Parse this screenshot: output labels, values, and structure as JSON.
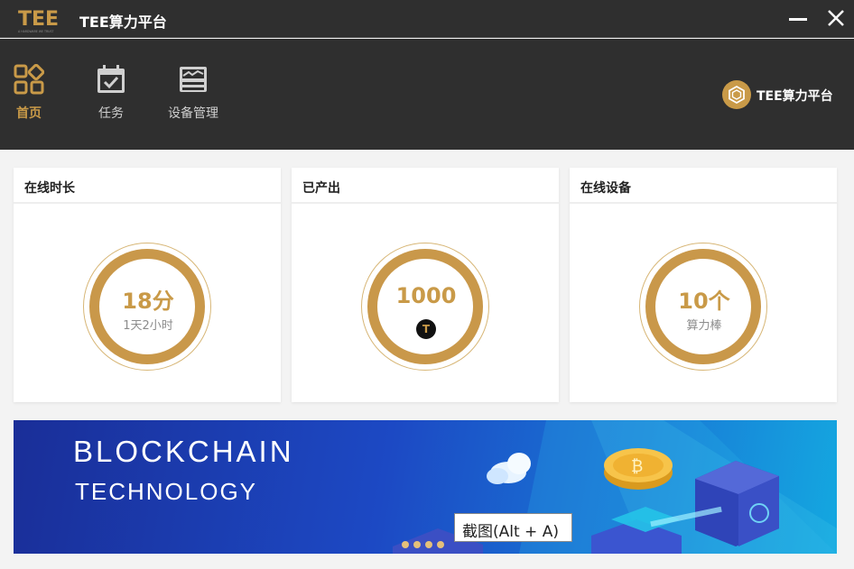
{
  "titlebar": {
    "logo_text": "TEE",
    "logo_tagline": "A HARDWARE WE TRUST",
    "title": "TEE算力平台"
  },
  "nav": {
    "items": [
      {
        "label": "首页",
        "icon": "grid-icon",
        "active": true
      },
      {
        "label": "任务",
        "icon": "calendar-check-icon",
        "active": false
      },
      {
        "label": "设备管理",
        "icon": "device-management-icon",
        "active": false
      }
    ],
    "brand_label": "TEE算力平台"
  },
  "cards": [
    {
      "title": "在线时长",
      "value": "18分",
      "sub": "1天2小时"
    },
    {
      "title": "已产出",
      "value": "1000",
      "coin_glyph": "T"
    },
    {
      "title": "在线设备",
      "value": "10个",
      "sub": "算力棒"
    }
  ],
  "banner": {
    "line1": "BLOCKCHAIN",
    "line2": "TECHNOLOGY",
    "coin_symbol": "₿",
    "slides": 4
  },
  "tooltip": {
    "text": "截图(Alt + A)"
  },
  "colors": {
    "accent": "#c99a48",
    "dark": "#2f2f2f",
    "banner_start": "#1a2e98",
    "banner_end": "#14a8e0"
  }
}
